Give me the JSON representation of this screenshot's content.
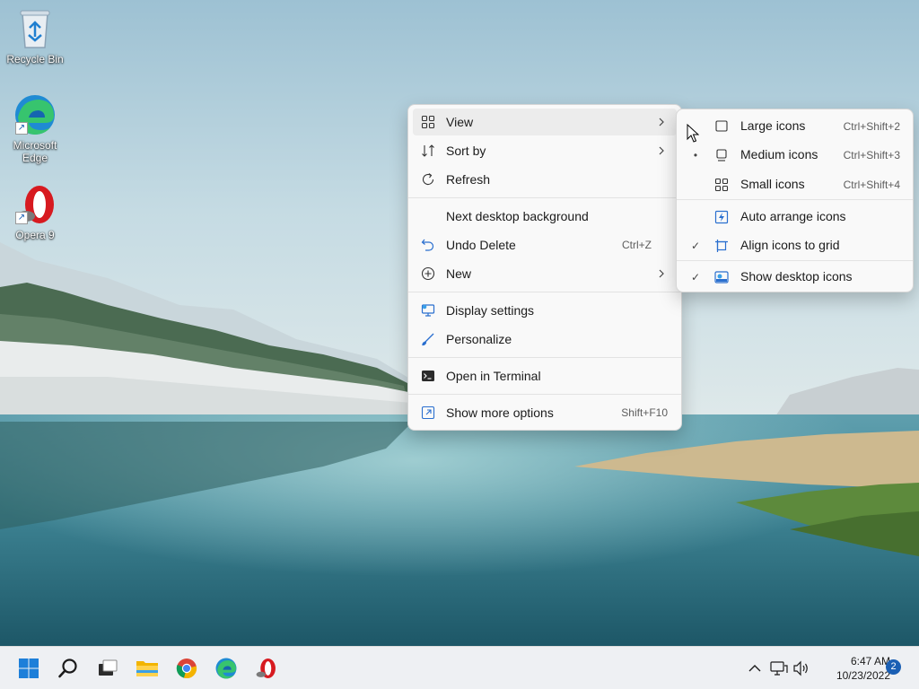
{
  "desktop": {
    "icons": [
      {
        "label": "Recycle Bin",
        "icon": "recycle-bin-icon"
      },
      {
        "label": "Microsoft Edge",
        "icon": "edge-icon"
      },
      {
        "label": "Opera 9",
        "icon": "opera-icon"
      }
    ]
  },
  "context_menu": {
    "items": [
      {
        "label": "View",
        "icon": "view-grid-icon",
        "has_submenu": true
      },
      {
        "label": "Sort by",
        "icon": "sort-icon",
        "has_submenu": true
      },
      {
        "label": "Refresh",
        "icon": "refresh-icon"
      },
      {
        "label": "Next desktop background"
      },
      {
        "label": "Undo Delete",
        "icon": "undo-icon",
        "shortcut": "Ctrl+Z"
      },
      {
        "label": "New",
        "icon": "new-plus-icon",
        "has_submenu": true
      },
      {
        "label": "Display settings",
        "icon": "display-settings-icon"
      },
      {
        "label": "Personalize",
        "icon": "personalize-brush-icon"
      },
      {
        "label": "Open in Terminal",
        "icon": "terminal-icon"
      },
      {
        "label": "Show more options",
        "icon": "show-more-options-icon",
        "shortcut": "Shift+F10"
      }
    ]
  },
  "view_submenu": {
    "items": [
      {
        "label": "Large icons",
        "icon": "large-icons-icon",
        "shortcut": "Ctrl+Shift+2",
        "marker": ""
      },
      {
        "label": "Medium icons",
        "icon": "medium-icons-icon",
        "shortcut": "Ctrl+Shift+3",
        "marker": "•"
      },
      {
        "label": "Small icons",
        "icon": "small-icons-icon",
        "shortcut": "Ctrl+Shift+4",
        "marker": ""
      },
      {
        "label": "Auto arrange icons",
        "icon": "auto-arrange-icon",
        "marker": ""
      },
      {
        "label": "Align icons to grid",
        "icon": "align-grid-icon",
        "marker": "✓"
      },
      {
        "label": "Show desktop icons",
        "icon": "show-desktop-icons-icon",
        "marker": "✓"
      }
    ]
  },
  "taskbar": {
    "apps": [
      "start-icon",
      "search-icon",
      "task-view-icon",
      "file-explorer-icon",
      "chrome-icon",
      "edge-icon",
      "opera-icon"
    ],
    "tray": {
      "icons": [
        "show-hidden-icons-chevron-icon",
        "network-icon",
        "volume-icon"
      ],
      "time": "6:47 AM",
      "date": "10/23/2022",
      "notification_count": "2"
    }
  },
  "colors": {
    "accent": "#1a5fb4",
    "menu_bg": "#f9f9f9",
    "taskbar_bg": "#eef0f3"
  }
}
